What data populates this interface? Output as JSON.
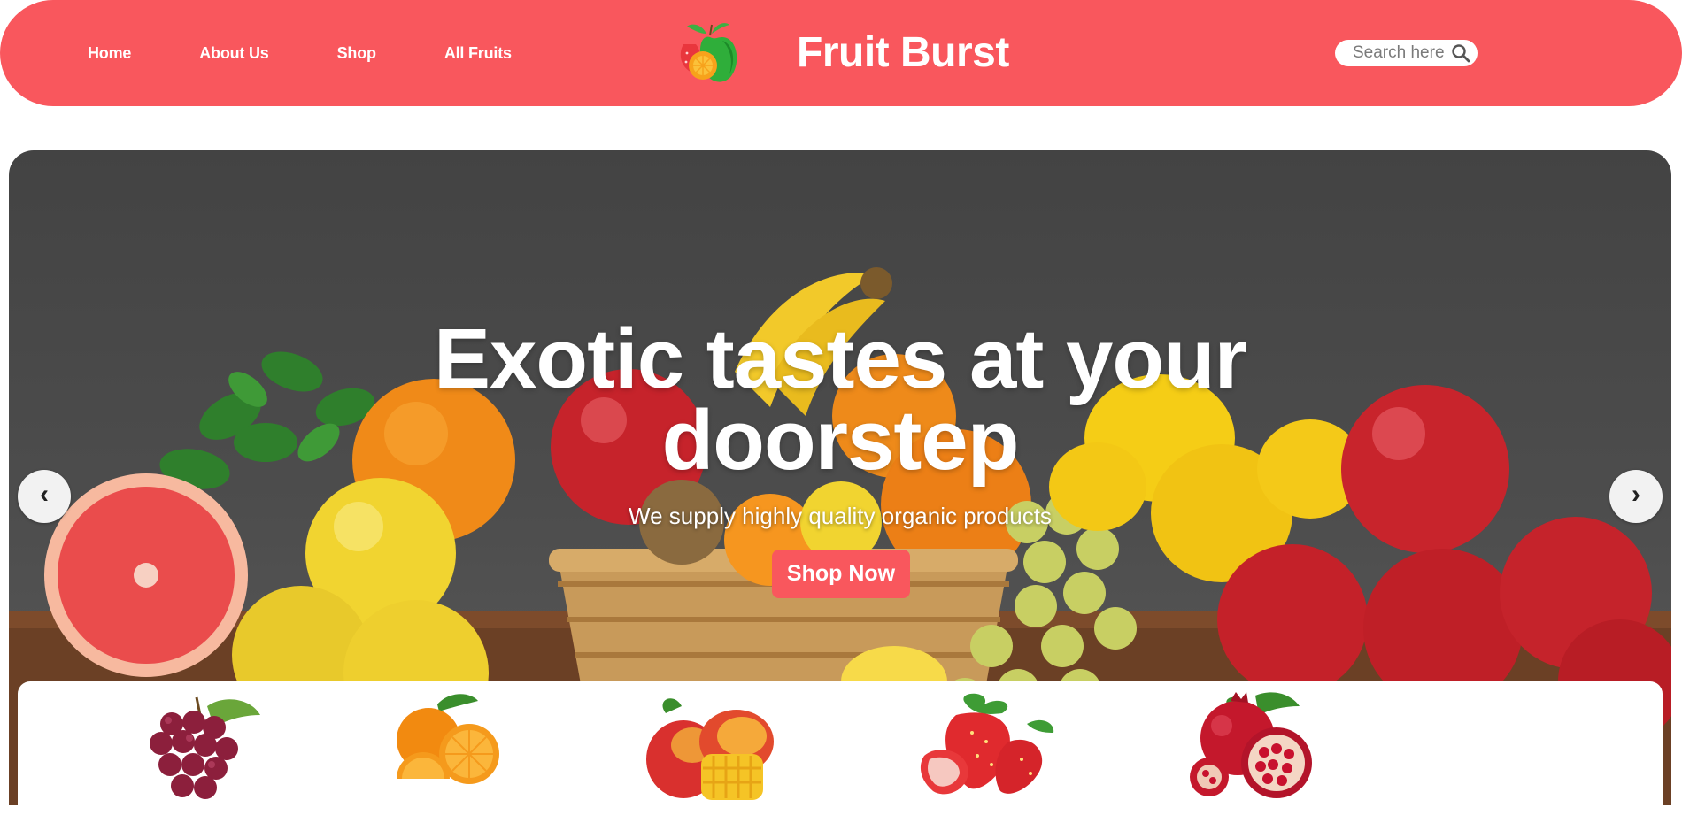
{
  "header": {
    "nav": [
      {
        "label": "Home"
      },
      {
        "label": "About Us"
      },
      {
        "label": "Shop"
      },
      {
        "label": "All Fruits"
      }
    ],
    "brand": "Fruit Burst",
    "search_placeholder": "Search here",
    "logo_icon": "fruit-logo-icon",
    "search_icon": "search-icon"
  },
  "hero": {
    "title": "Exotic tastes at your doorstep",
    "subtitle": "We supply highly quality organic products",
    "cta_label": "Shop Now",
    "prev_label": "‹",
    "next_label": "›"
  },
  "fruit_strip": {
    "items": [
      {
        "icon": "grapes-icon"
      },
      {
        "icon": "orange-icon"
      },
      {
        "icon": "mango-icon"
      },
      {
        "icon": "strawberry-icon"
      },
      {
        "icon": "pomegranate-icon"
      }
    ]
  },
  "colors": {
    "brand": "#f9575d",
    "hero_background": "#474747",
    "text_light": "#ffffff"
  }
}
